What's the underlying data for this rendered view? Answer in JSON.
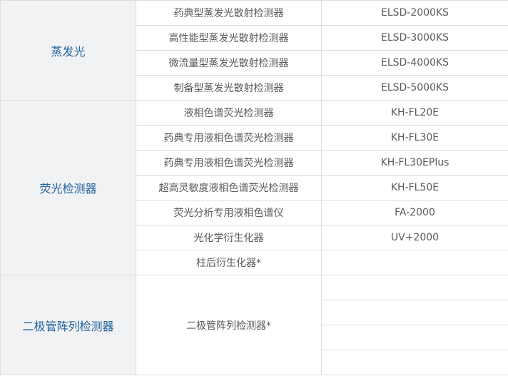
{
  "table": {
    "categories": [
      {
        "label": "蒸发光"
      },
      {
        "label": "荧光检测器"
      },
      {
        "label": "二极管阵列检测器"
      }
    ],
    "rows": [
      {
        "name": "药典型蒸发光散射检测器",
        "model": "ELSD-2000KS"
      },
      {
        "name": "高性能型蒸发光散射检测器",
        "model": "ELSD-3000KS"
      },
      {
        "name": "微流量型蒸发光散射检测器",
        "model": "ELSD-4000KS"
      },
      {
        "name": "制备型蒸发光散射检测器",
        "model": "ELSD-5000KS"
      },
      {
        "name": "液相色谱荧光检测器",
        "model": "KH-FL20E"
      },
      {
        "name": "药典专用液相色谱荧光检测器",
        "model": "KH-FL30E"
      },
      {
        "name": "药典专用液相色谱荧光检测器",
        "model": "KH-FL30EPlus"
      },
      {
        "name": "超高灵敏度液相色谱荧光检测器",
        "model": "KH-FL50E"
      },
      {
        "name": "荧光分析专用液相色谱仪",
        "model": "FA-2000"
      },
      {
        "name": "光化学衍生化器",
        "model": "UV+2000"
      },
      {
        "name": "柱后衍生化器*",
        "model": ""
      },
      {
        "name": "二极管阵列检测器*",
        "model": ""
      }
    ]
  }
}
